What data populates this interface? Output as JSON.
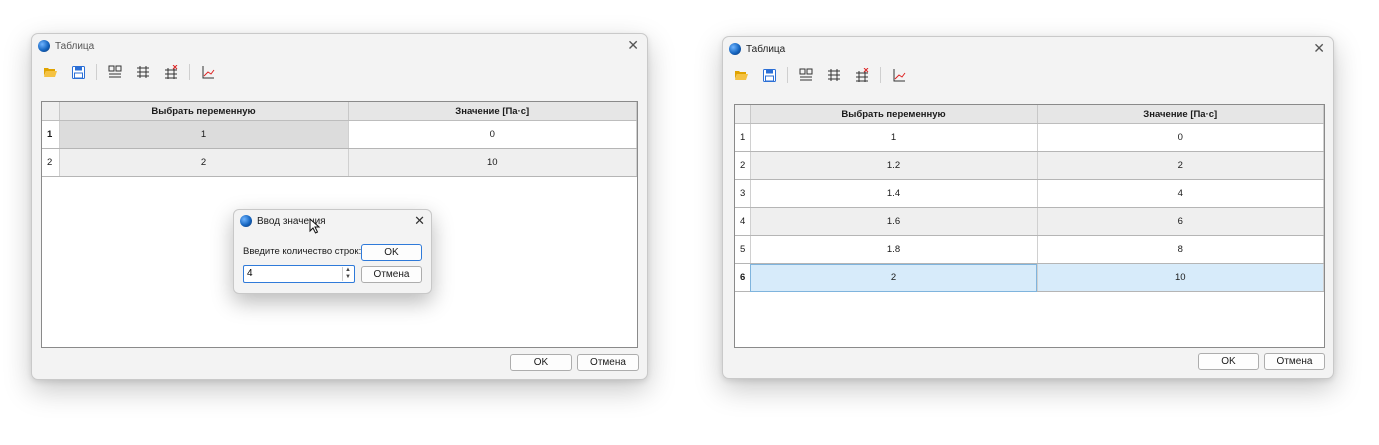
{
  "colors": {
    "accent": "#2f7ad9",
    "selection": "#d7ebfa"
  },
  "left_window": {
    "title": "Таблица",
    "close_icon": "close-icon",
    "toolbar": [
      "folder-open-icon",
      "save-icon",
      "insert-row-icon",
      "add-rows-icon",
      "delete-rows-icon",
      "chart-icon"
    ],
    "columns": [
      "Выбрать переменную",
      "Значение [Па·с]"
    ],
    "rows": [
      {
        "num": "1",
        "var": "1",
        "val": "0"
      },
      {
        "num": "2",
        "var": "2",
        "val": "10"
      }
    ],
    "ok_label": "OK",
    "cancel_label": "Отмена",
    "dialog": {
      "title": "Ввод значения",
      "label": "Введите количество строк:",
      "value": "4",
      "ok_label": "OK",
      "cancel_label": "Отмена"
    }
  },
  "right_window": {
    "title": "Таблица",
    "columns": [
      "Выбрать переменную",
      "Значение [Па·с]"
    ],
    "rows": [
      {
        "num": "1",
        "var": "1",
        "val": "0"
      },
      {
        "num": "2",
        "var": "1.2",
        "val": "2"
      },
      {
        "num": "3",
        "var": "1.4",
        "val": "4"
      },
      {
        "num": "4",
        "var": "1.6",
        "val": "6"
      },
      {
        "num": "5",
        "var": "1.8",
        "val": "8"
      },
      {
        "num": "6",
        "var": "2",
        "val": "10"
      }
    ],
    "selected_row": "6",
    "ok_label": "OK",
    "cancel_label": "Отмена"
  }
}
